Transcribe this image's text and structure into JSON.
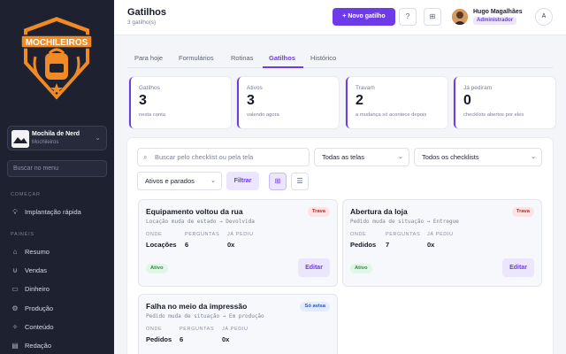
{
  "sidebar": {
    "team": {
      "name": "Mochila de Nerd",
      "sub": "Mochileiros"
    },
    "search_placeholder": "Buscar no menu",
    "section_start": "COMEÇAR",
    "quick": {
      "label": "Implantação rápida",
      "icon": "lightbulb-icon"
    },
    "section_panels": "PAINÉIS",
    "items": [
      {
        "label": "Resumo",
        "icon": "home-icon"
      },
      {
        "label": "Vendas",
        "icon": "cart-icon"
      },
      {
        "label": "Dinheiro",
        "icon": "cash-icon"
      },
      {
        "label": "Produção",
        "icon": "gear-icon"
      },
      {
        "label": "Conteúdo",
        "icon": "sparkle-icon"
      },
      {
        "label": "Redação",
        "icon": "document-icon"
      }
    ],
    "logo_text": "MOCHILEIROS"
  },
  "header": {
    "title": "Gatilhos",
    "subtitle": "3 gatilho(s)",
    "new_button": "+ Novo gatilho",
    "user_name": "Hugo Magalhães",
    "user_role": "Administrador",
    "avatar_letter": "A"
  },
  "tabs": [
    {
      "label": "Para hoje"
    },
    {
      "label": "Formulários"
    },
    {
      "label": "Rotinas"
    },
    {
      "label": "Gatilhos"
    },
    {
      "label": "Histórico"
    }
  ],
  "stats": [
    {
      "label": "Gatilhos",
      "value": "3",
      "note": "nesta conta"
    },
    {
      "label": "Ativos",
      "value": "3",
      "note": "valendo agora"
    },
    {
      "label": "Travam",
      "value": "2",
      "note": "a mudança só acontece depois"
    },
    {
      "label": "Já pediram",
      "value": "0",
      "note": "checklists abertos por eles"
    }
  ],
  "filters": {
    "search_placeholder": "Buscar pelo checklist ou pela tela",
    "screens": "Todas as telas",
    "checklists": "Todos os checklists",
    "state": "Ativos e parados",
    "filter_button": "Filtrar"
  },
  "card_labels": {
    "where": "ONDE",
    "questions": "PERGUNTAS",
    "asked": "JÁ PEDIU",
    "edit": "Editar"
  },
  "cards": [
    {
      "title": "Equipamento voltou da rua",
      "desc": "Locação muda de estado → Devolvida",
      "badge": "Trava",
      "badge_color": "#c62828",
      "where": "Locações",
      "questions": "6",
      "asked": "0x",
      "status": "Ativo"
    },
    {
      "title": "Abertura da loja",
      "desc": "Pedido muda de situação → Entregue",
      "badge": "Trava",
      "badge_color": "#c62828",
      "where": "Pedidos",
      "questions": "7",
      "asked": "0x",
      "status": "Ativo"
    },
    {
      "title": "Falha no meio da impressão",
      "desc": "Pedido muda de situação → Em produção",
      "badge": "Só avisa",
      "badge_color": "#2856c6",
      "where": "Pedidos",
      "questions": "6",
      "asked": "0x",
      "status": ""
    }
  ]
}
